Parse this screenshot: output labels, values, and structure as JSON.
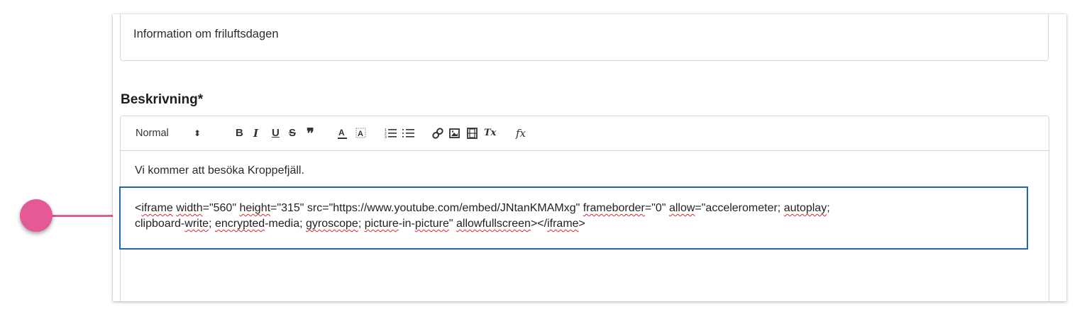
{
  "title_field": {
    "value": "Information om friluftsdagen"
  },
  "description": {
    "label": "Beskrivning*",
    "toolbar": {
      "format_select": "Normal",
      "format_caret": "⬍",
      "bold": "B",
      "italic": "I",
      "underline": "U",
      "strike": "S",
      "blockquote": "❞",
      "font_color": "A",
      "background_color": "A",
      "ordered_list": "☷",
      "bullet_list": "☰",
      "link": "🔗",
      "image": "▣",
      "video": "▤",
      "clean": "Tx",
      "formula": "fx"
    },
    "paragraph_1": "Vi kommer att besöka Kroppefjäll.",
    "code": {
      "t01": "<",
      "t02": "iframe",
      "t03": " ",
      "t04": "width",
      "t05": "=\"560\" ",
      "t06": "height",
      "t07": "=\"315\" src=\"https://www.youtube.com/embed/JNtanKMAMxg\" ",
      "t08": "frameborder",
      "t09": "=\"0\" ",
      "t10": "allow",
      "t11": "=\"accelerometer; ",
      "t12": "autoplay",
      "t13": ";",
      "t14": "clipboard-",
      "t15": "write",
      "t16": "; ",
      "t17": "encrypted",
      "t18": "-media; ",
      "t19": "gyroscope",
      "t20": "; ",
      "t21": "picture",
      "t22": "-in-",
      "t23": "picture",
      "t24": "\" ",
      "t25": "allowfullscreen",
      "t26": "></",
      "t27": "iframe",
      "t28": ">"
    }
  },
  "colors": {
    "highlight_border": "#1f67b1",
    "callout": "#e45a96",
    "spellcheck": "#d22b2b"
  }
}
